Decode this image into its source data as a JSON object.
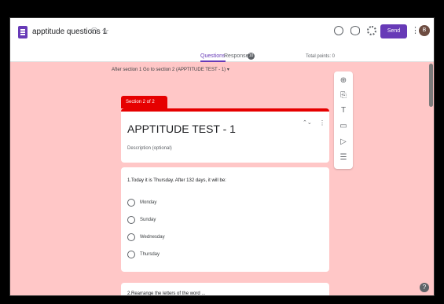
{
  "header": {
    "title": "apptitude questions 1",
    "send_label": "Send",
    "avatar_initial": "B"
  },
  "tabs": {
    "questions": "Questions",
    "responses": "Responses",
    "responses_count": "10",
    "total_points": "Total points: 0"
  },
  "after_section": "After section 1  Go to section 2 (APPTITUDE TEST - 1)  ▾",
  "section": {
    "label": "Section 2 of 2",
    "title": "APPTITUDE TEST - 1",
    "description_placeholder": "Description (optional)"
  },
  "question": {
    "text": "1.Today it is Thursday. After 132 days, it will be:",
    "options": [
      "Monday",
      "Sunday",
      "Wednesday",
      "Thursday"
    ]
  },
  "next_question_text": "2.Rearrange the letters of the word ...",
  "icons": {
    "toolbar": [
      "add-question-icon",
      "import-icon",
      "title-icon",
      "image-icon",
      "video-icon",
      "add-section-icon"
    ]
  }
}
